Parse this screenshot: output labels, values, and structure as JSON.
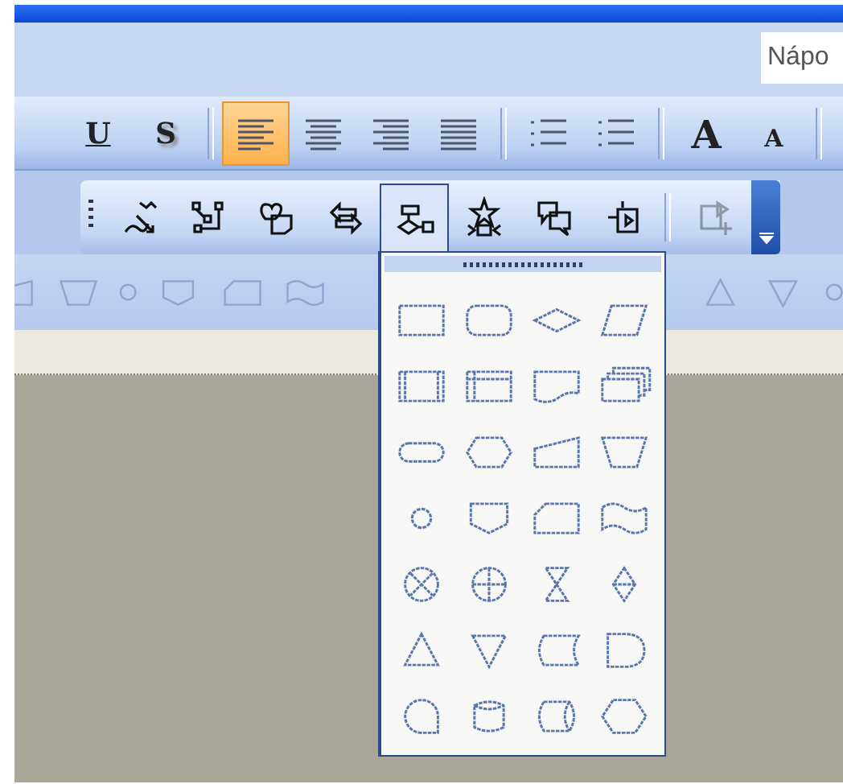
{
  "font_field": {
    "value": "Nápo"
  },
  "format_toolbar": [
    {
      "kind": "underline",
      "label": "U",
      "selected": false
    },
    {
      "kind": "shadow",
      "label": "S",
      "selected": false
    },
    {
      "kind": "separator"
    },
    {
      "kind": "align_left",
      "selected": true
    },
    {
      "kind": "align_center",
      "selected": false
    },
    {
      "kind": "align_right",
      "selected": false
    },
    {
      "kind": "justify",
      "selected": false
    },
    {
      "kind": "separator"
    },
    {
      "kind": "numbering",
      "selected": false
    },
    {
      "kind": "bullets",
      "selected": false
    },
    {
      "kind": "separator"
    },
    {
      "kind": "grow_font",
      "label": "A",
      "selected": false
    },
    {
      "kind": "shrink_font",
      "label": "A",
      "selected": false
    },
    {
      "kind": "separator"
    }
  ],
  "drawing_toolbar": [
    {
      "kind": "lines",
      "selected": false,
      "disabled": false
    },
    {
      "kind": "connector",
      "selected": false,
      "disabled": false
    },
    {
      "kind": "basic",
      "selected": false,
      "disabled": false
    },
    {
      "kind": "arrows",
      "selected": false,
      "disabled": false
    },
    {
      "kind": "flowchart",
      "selected": true,
      "disabled": false
    },
    {
      "kind": "stars",
      "selected": false,
      "disabled": false
    },
    {
      "kind": "callouts",
      "selected": false,
      "disabled": false
    },
    {
      "kind": "action",
      "selected": false,
      "disabled": false
    },
    {
      "kind": "separator"
    },
    {
      "kind": "more",
      "selected": false,
      "disabled": true
    }
  ],
  "shape_menu": {
    "open": true
  }
}
